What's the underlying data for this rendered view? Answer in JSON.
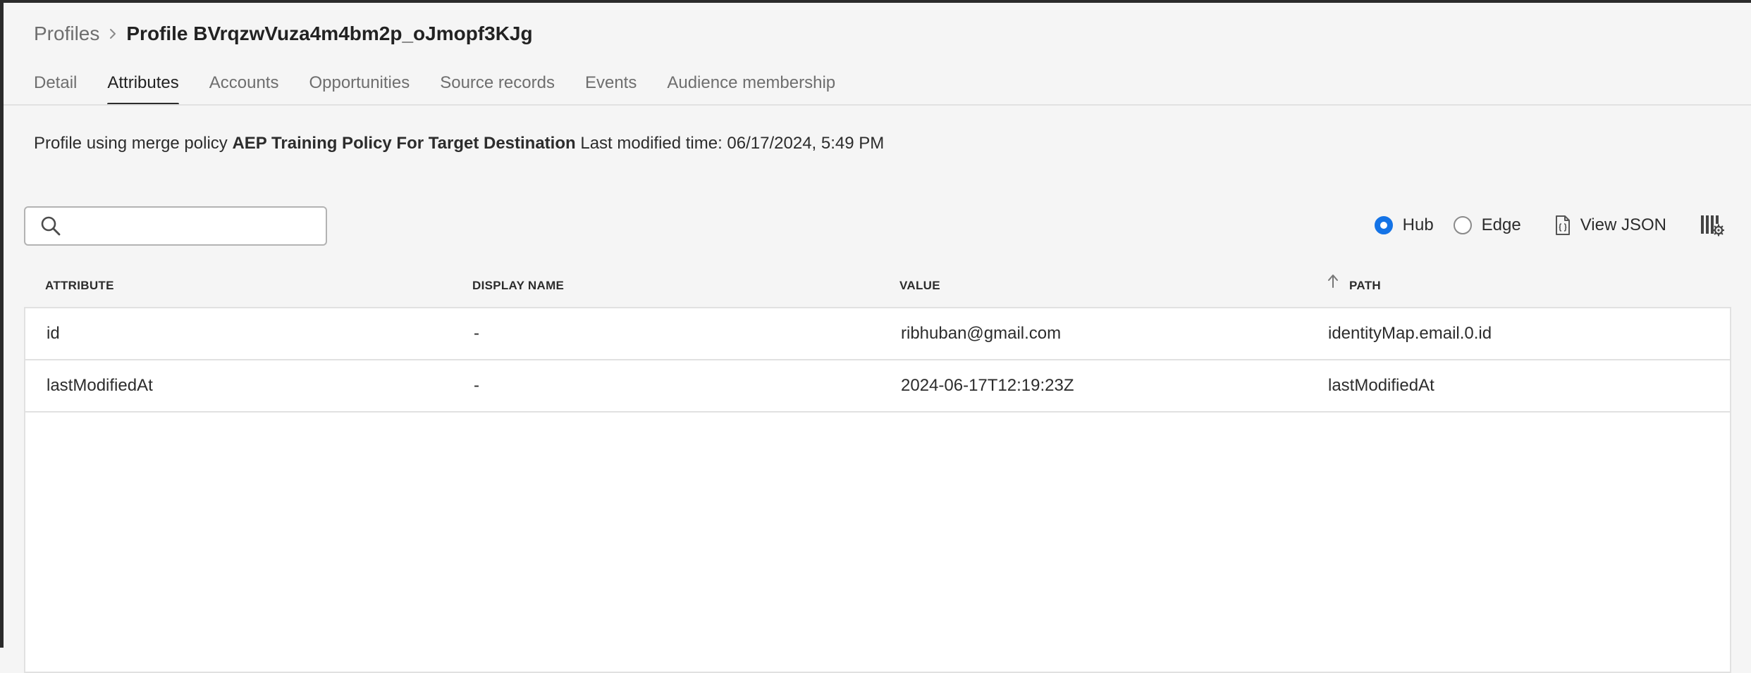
{
  "breadcrumb": {
    "parent": "Profiles",
    "current": "Profile BVrqzwVuza4m4bm2p_oJmopf3KJg"
  },
  "tabs": [
    {
      "label": "Detail",
      "active": false
    },
    {
      "label": "Attributes",
      "active": true
    },
    {
      "label": "Accounts",
      "active": false
    },
    {
      "label": "Opportunities",
      "active": false
    },
    {
      "label": "Source records",
      "active": false
    },
    {
      "label": "Events",
      "active": false
    },
    {
      "label": "Audience membership",
      "active": false
    }
  ],
  "policy": {
    "prefix": "Profile using merge policy",
    "name": "AEP Training Policy For Target Destination",
    "modified": "Last modified time: 06/17/2024, 5:49 PM"
  },
  "search": {
    "value": "",
    "icon": "search-icon"
  },
  "toolbar": {
    "radio_hub": "Hub",
    "radio_edge": "Edge",
    "selected": "Hub",
    "view_json": "View JSON",
    "accent_color": "#1473e6"
  },
  "table": {
    "columns": [
      "ATTRIBUTE",
      "DISPLAY NAME",
      "VALUE",
      "PATH"
    ],
    "sorted_column": "PATH",
    "sort_direction": "ascending",
    "rows": [
      {
        "attribute": "id",
        "display_name": "-",
        "value": "ribhuban@gmail.com",
        "path": "identityMap.email.0.id"
      },
      {
        "attribute": "lastModifiedAt",
        "display_name": "-",
        "value": "2024-06-17T12:19:23Z",
        "path": "lastModifiedAt"
      }
    ]
  }
}
